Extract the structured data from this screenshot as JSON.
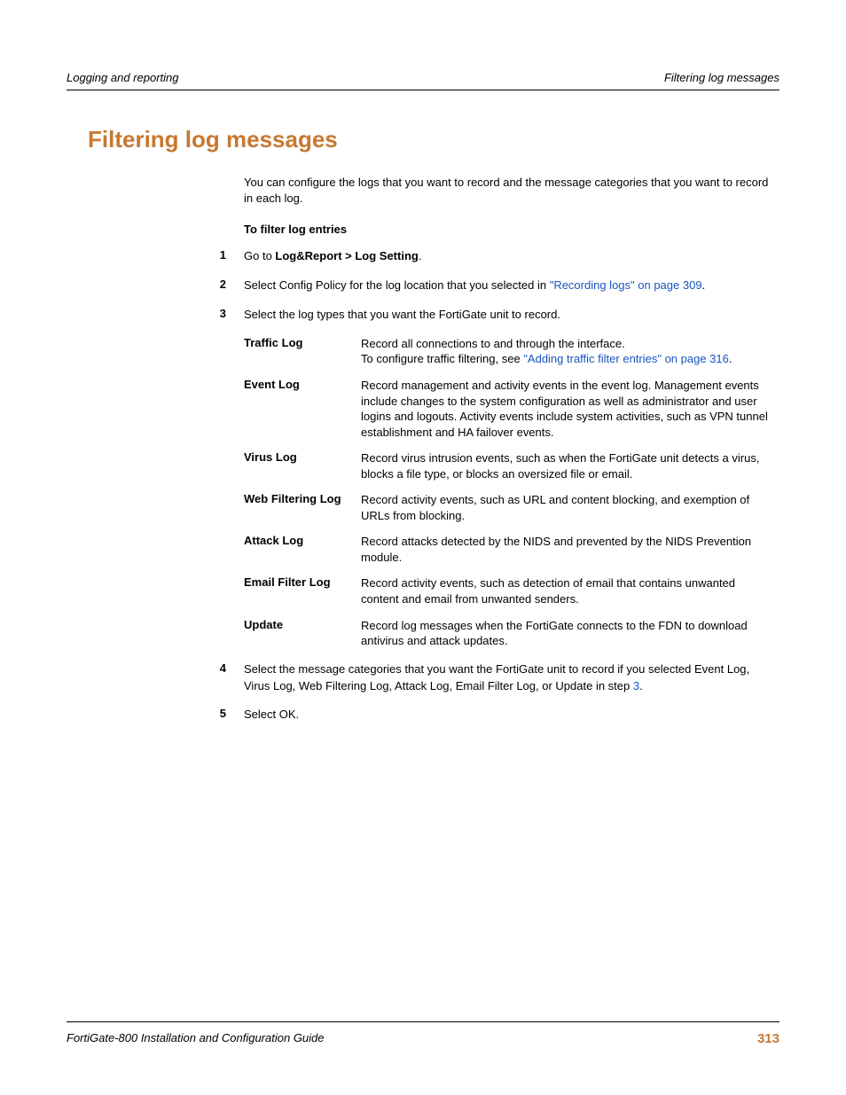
{
  "header": {
    "left": "Logging and reporting",
    "right": "Filtering log messages"
  },
  "title": "Filtering log messages",
  "intro": "You can configure the logs that you want to record and the message categories that you want to record in each log.",
  "subhead": "To filter log entries",
  "steps": {
    "s1_num": "1",
    "s1_a": "Go to ",
    "s1_b": "Log&Report > Log Setting",
    "s1_c": ".",
    "s2_num": "2",
    "s2_a": "Select Config Policy for the log location that you selected in ",
    "s2_link": "\"Recording logs\" on page 309",
    "s2_b": ".",
    "s3_num": "3",
    "s3": "Select the log types that you want the FortiGate unit to record.",
    "s4_num": "4",
    "s4_a": "Select the message categories that you want the FortiGate unit to record if you selected Event Log, Virus Log, Web Filtering Log, Attack Log, Email Filter Log, or Update in step ",
    "s4_link": "3",
    "s4_b": ".",
    "s5_num": "5",
    "s5": "Select OK."
  },
  "logs": {
    "traffic_label": "Traffic Log",
    "traffic_a": "Record all connections to and through the interface.",
    "traffic_b": "To configure traffic filtering, see ",
    "traffic_link": "\"Adding traffic filter entries\" on page 316",
    "traffic_c": ".",
    "event_label": "Event Log",
    "event": "Record management and activity events in the event log. Management events include changes to the system configuration as well as administrator and user logins and logouts. Activity events include system activities, such as VPN tunnel establishment and HA failover events.",
    "virus_label": "Virus Log",
    "virus": "Record virus intrusion events, such as when the FortiGate unit detects a virus, blocks a file type, or blocks an oversized file or email.",
    "web_label": "Web Filtering Log",
    "web": "Record activity events, such as URL and content blocking, and exemption of URLs from blocking.",
    "attack_label": "Attack Log",
    "attack": "Record attacks detected by the NIDS and prevented by the NIDS Prevention module.",
    "email_label": "Email Filter Log",
    "email": "Record activity events, such as detection of email that contains unwanted content and email from unwanted senders.",
    "update_label": "Update",
    "update": "Record log messages when the FortiGate connects to the FDN to download antivirus and attack updates."
  },
  "footer": {
    "left": "FortiGate-800 Installation and Configuration Guide",
    "page": "313"
  }
}
